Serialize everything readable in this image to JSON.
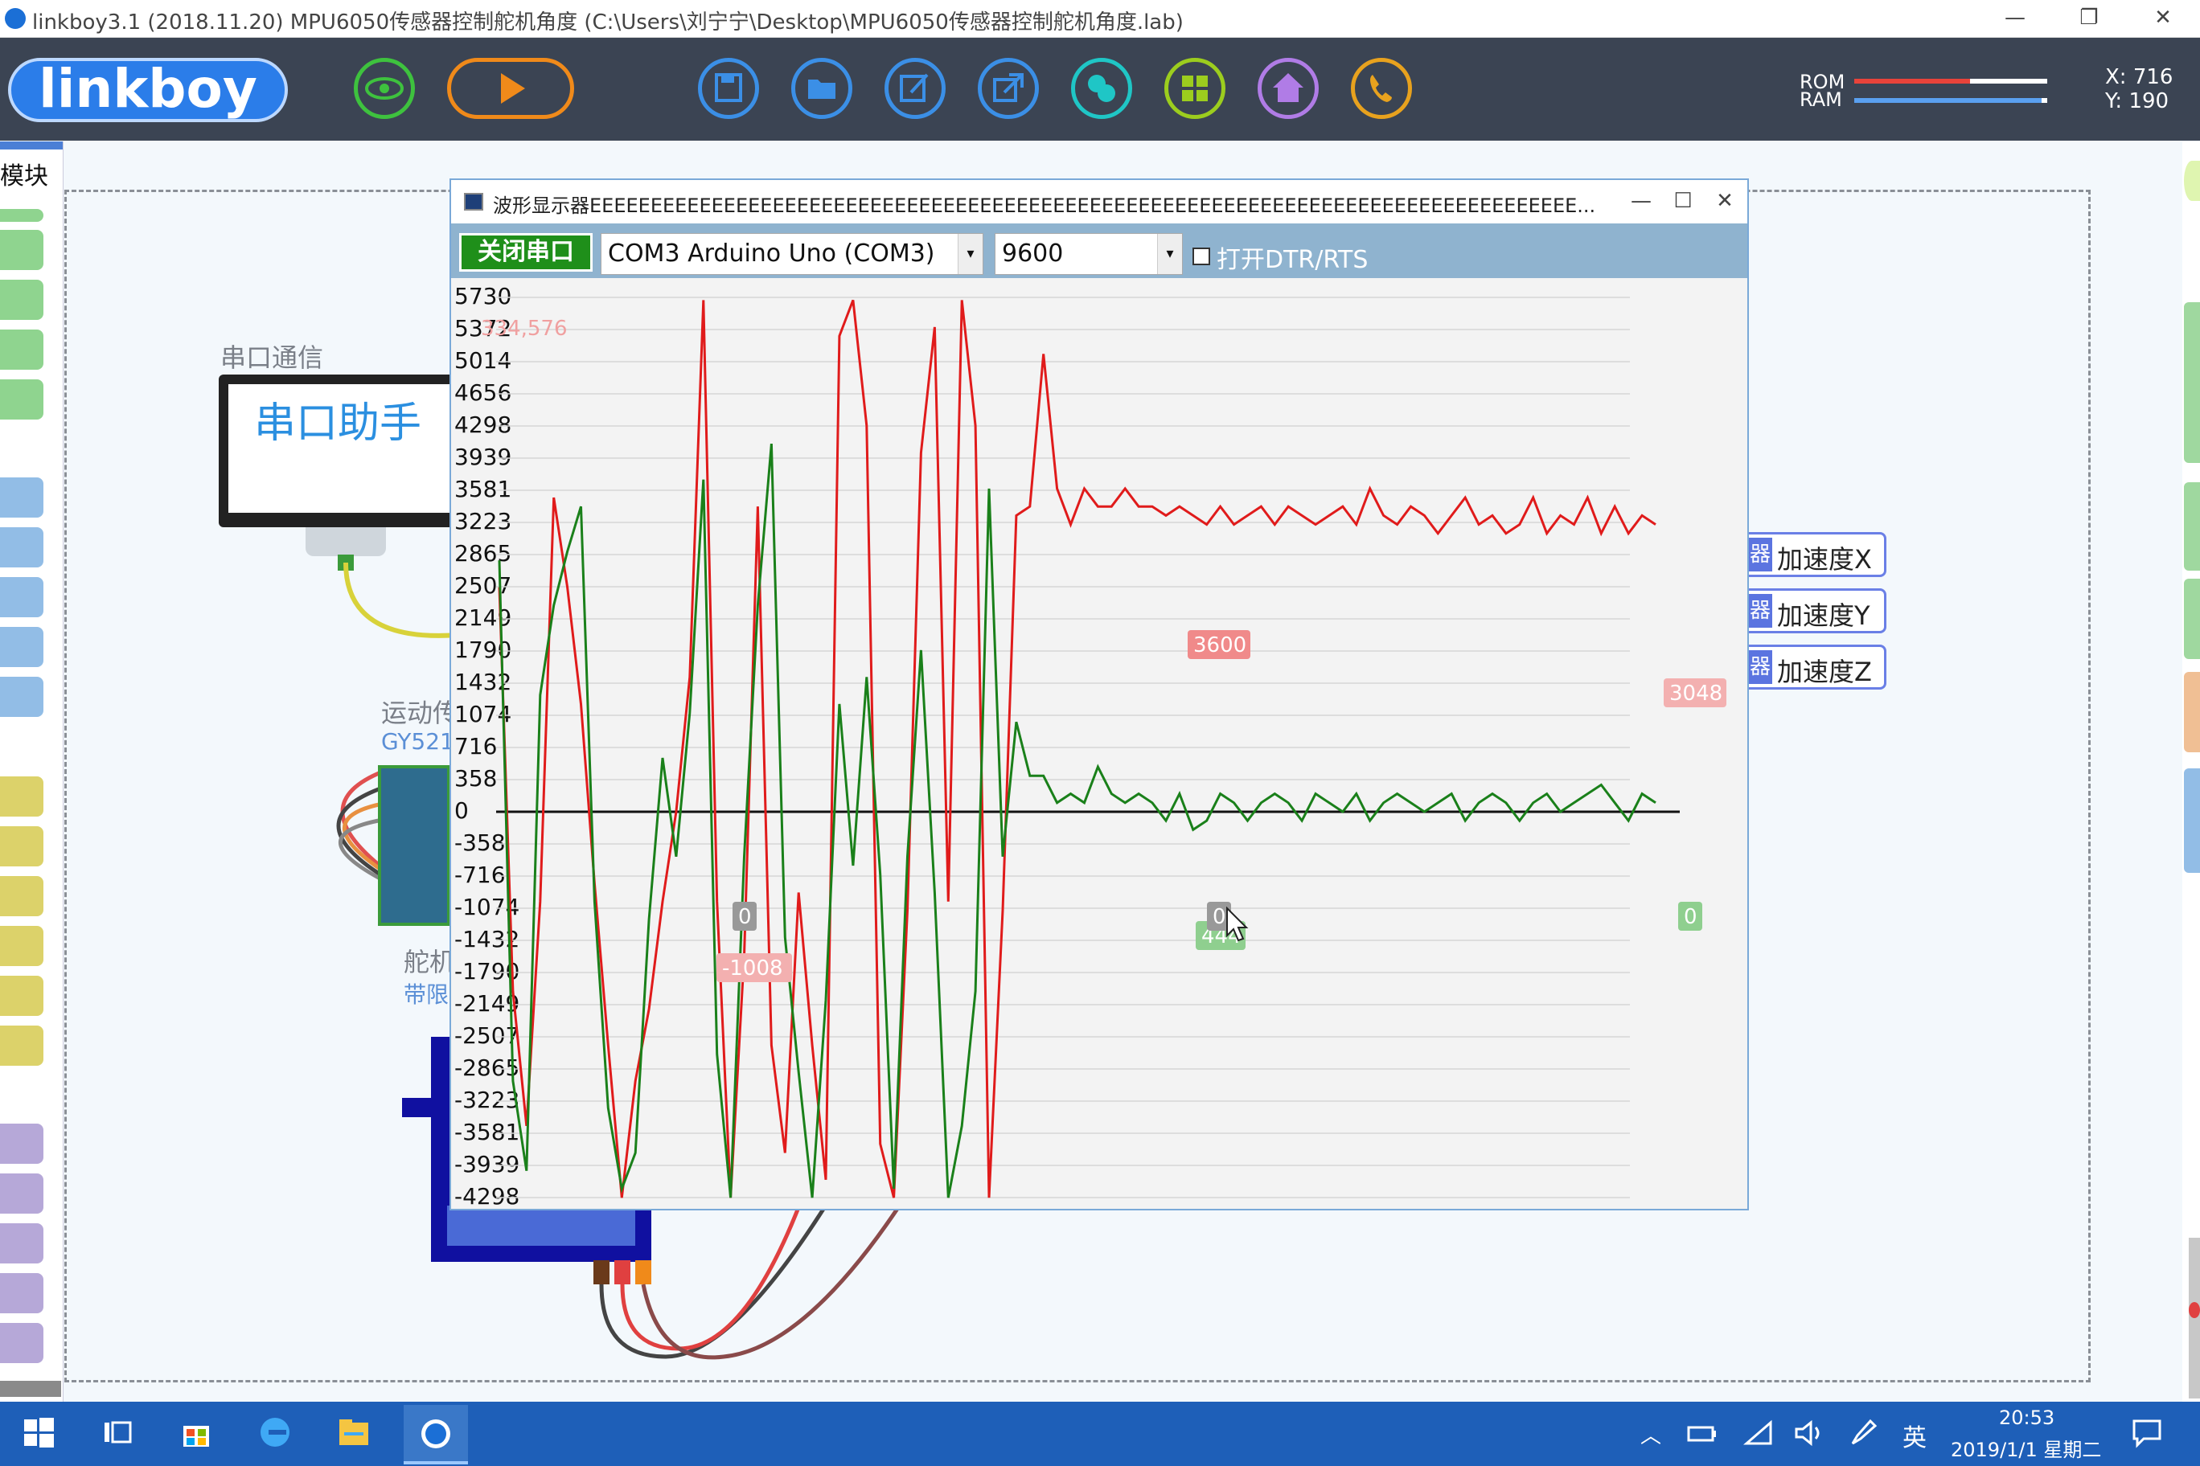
{
  "window": {
    "title": "linkboy3.1 (2018.11.20) MPU6050传感器控制舵机角度 (C:\\Users\\刘宁宁\\Desktop\\MPU6050传感器控制舵机角度.lab)",
    "minimize": "—",
    "restore": "❐",
    "close": "✕"
  },
  "toolbar": {
    "logo": "linkboy",
    "buttons": [
      {
        "name": "preview-eye-icon",
        "color": "#3ec23e"
      },
      {
        "name": "run-play-icon",
        "color": "#f08a1a"
      },
      {
        "name": "save-icon",
        "color": "#3b8fe6"
      },
      {
        "name": "open-folder-icon",
        "color": "#3b8fe6"
      },
      {
        "name": "edit-icon",
        "color": "#3b8fe6"
      },
      {
        "name": "export-icon",
        "color": "#3b8fe6"
      },
      {
        "name": "python-icon",
        "color": "#1fc6c6"
      },
      {
        "name": "modules-grid-icon",
        "color": "#9ccd1e"
      },
      {
        "name": "home-icon",
        "color": "#b07ce6"
      },
      {
        "name": "phone-icon",
        "color": "#e8a21e"
      }
    ],
    "rom_label": "ROM",
    "ram_label": "RAM",
    "rom_usage": 0.6,
    "ram_usage": 0.97,
    "x_readout": "X: 716",
    "y_readout": "Y: 190"
  },
  "sidebar": {
    "module_tab": "模块"
  },
  "canvas": {
    "serial_label": "串口通信",
    "serial_monitor_text": "串口助手",
    "motion_label": "运动传",
    "motion_sub": "GY521",
    "servo_label": "舵机",
    "servo_sub": "带限"
  },
  "wave_window": {
    "title": "波形显示器EEEEEEEEEEEEEEEEEEEEEEEEEEEEEEEEEEEEEEEEEEEEEEEEEEEEEEEEEEEEEEEEEEEEEEEEEEEEEEEEE...",
    "close_port": "关闭串口",
    "port": "COM3 Arduino Uno (COM3)",
    "baud": "9600",
    "dtr_label": "打开DTR/RTS",
    "y_ticks": [
      "5730",
      "5372",
      "5014",
      "4656",
      "4298",
      "3939",
      "3581",
      "3223",
      "2865",
      "2507",
      "2149",
      "1790",
      "1432",
      "1074",
      "716",
      "358",
      "0",
      "-358",
      "-716",
      "-1074",
      "-1432",
      "-1790",
      "-2149",
      "-2507",
      "-2865",
      "-3223",
      "-3581",
      "-3939",
      "-4298"
    ],
    "annotations": {
      "red_top": "334,576",
      "red_mid": "3600",
      "red_end": "3048",
      "red_low": "-1008",
      "green_mid": "444",
      "zero_a": "0",
      "zero_b": "0",
      "zero_c": "0"
    }
  },
  "sensor_tags": [
    "加速度X",
    "加速度Y",
    "加速度Z"
  ],
  "sensor_tag_prefix": "器",
  "taskbar": {
    "ime": "英",
    "time": "20:53",
    "date": "2019/1/1 星期二"
  },
  "chart_data": {
    "type": "line",
    "ylim": [
      -4298,
      5730
    ],
    "series": [
      {
        "color": "#e01b1b",
        "values": [
          2500,
          -2000,
          -3500,
          -1000,
          3500,
          2500,
          1200,
          -800,
          -2600,
          -4300,
          -3000,
          -2200,
          -1000,
          0,
          1500,
          5700,
          -1000,
          -4300,
          -1600,
          3400,
          -2600,
          -3800,
          -900,
          -2600,
          -4100,
          5300,
          5700,
          4300,
          -3700,
          -4300,
          -1100,
          4000,
          5400,
          -1000,
          5700,
          4300,
          -4300,
          -1100,
          3300,
          3400,
          5100,
          3600,
          3200,
          3600,
          3400,
          3400,
          3600,
          3400,
          3400,
          3300,
          3400,
          3300,
          3200,
          3400,
          3200,
          3300,
          3400,
          3200,
          3400,
          3300,
          3200,
          3300,
          3400,
          3200,
          3600,
          3300,
          3200,
          3400,
          3300,
          3100,
          3300,
          3500,
          3200,
          3300,
          3100,
          3200,
          3500,
          3100,
          3300,
          3200,
          3500,
          3100,
          3400,
          3100,
          3300,
          3200
        ]
      },
      {
        "color": "#1a801a",
        "values": [
          2800,
          -3000,
          -4000,
          1300,
          2300,
          2900,
          3400,
          -1000,
          -3300,
          -4200,
          -3800,
          -1200,
          600,
          -500,
          1100,
          3700,
          -2700,
          -4300,
          -500,
          2300,
          4100,
          -1400,
          -2900,
          -4300,
          -2100,
          1200,
          -600,
          1500,
          -700,
          -4200,
          -500,
          1800,
          -900,
          -4300,
          -3500,
          -2000,
          3600,
          -500,
          1000,
          400,
          400,
          100,
          200,
          100,
          500,
          200,
          100,
          200,
          100,
          -100,
          200,
          -200,
          -100,
          200,
          100,
          -100,
          100,
          200,
          100,
          -100,
          200,
          100,
          0,
          200,
          -100,
          100,
          200,
          100,
          0,
          100,
          200,
          -100,
          100,
          200,
          100,
          -100,
          100,
          200,
          0,
          100,
          200,
          300,
          100,
          -100,
          200,
          100
        ]
      }
    ],
    "ytick_labels": [
      "5730",
      "5372",
      "5014",
      "4656",
      "4298",
      "3939",
      "3581",
      "3223",
      "2865",
      "2507",
      "2149",
      "1790",
      "1432",
      "1074",
      "716",
      "358",
      "0",
      "-358",
      "-716",
      "-1074",
      "-1432",
      "-1790",
      "-2149",
      "-2507",
      "-2865",
      "-3223",
      "-3581",
      "-3939",
      "-4298"
    ],
    "grid": true
  }
}
